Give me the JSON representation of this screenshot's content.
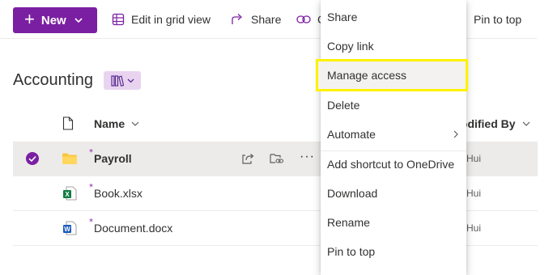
{
  "toolbar": {
    "new_label": "New",
    "edit_grid_label": "Edit in grid view",
    "share_label": "Share",
    "copy_link_label_partial": "C",
    "pin_label": "Pin to top"
  },
  "library": {
    "title": "Accounting"
  },
  "columns": {
    "name": "Name",
    "modified_by": "lodified By"
  },
  "files": [
    {
      "name": "Payroll",
      "type": "folder",
      "modified_by": "e Hui",
      "selected": true
    },
    {
      "name": "Book.xlsx",
      "type": "excel",
      "modified_by": "e Hui",
      "selected": false
    },
    {
      "name": "Document.docx",
      "type": "word",
      "modified_by": "e Hui",
      "selected": false
    }
  ],
  "context_menu": {
    "items": [
      {
        "label": "Share"
      },
      {
        "label": "Copy link"
      },
      {
        "label": "Manage access",
        "highlighted": true
      },
      {
        "label": "Delete"
      },
      {
        "label": "Automate",
        "has_submenu": true
      },
      {
        "label": "Add shortcut to OneDrive"
      },
      {
        "label": "Download"
      },
      {
        "label": "Rename"
      },
      {
        "label": "Pin to top"
      }
    ]
  },
  "colors": {
    "accent": "#7b1fa2",
    "highlight_outline": "#fff200",
    "selected_row": "#edebe9"
  }
}
